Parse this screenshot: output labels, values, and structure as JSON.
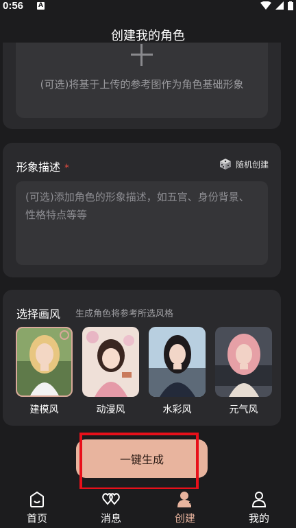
{
  "status": {
    "time": "0:56",
    "notification_letter": "A"
  },
  "header": {
    "title": "创建我的角色"
  },
  "upload": {
    "hint": "(可选)将基于上传的参考图作为角色基础形象"
  },
  "appearance": {
    "title": "形象描述",
    "required_mark": "*",
    "random_label": "随机创建",
    "placeholder": "(可选)添加角色的形象描述，如五官、身份背景、性格特点等等"
  },
  "style": {
    "title": "选择画风",
    "subtitle": "生成角色将参考所选风格",
    "options": [
      {
        "label": "建模风",
        "selected": true
      },
      {
        "label": "动漫风",
        "selected": false
      },
      {
        "label": "水彩风",
        "selected": false
      },
      {
        "label": "元气风",
        "selected": false
      }
    ]
  },
  "generate_label": "一键生成",
  "tabs": [
    {
      "label": "首页",
      "icon": "home-icon"
    },
    {
      "label": "消息",
      "icon": "hearts-icon"
    },
    {
      "label": "创建",
      "icon": "create-user-icon",
      "active": true
    },
    {
      "label": "我的",
      "icon": "profile-icon"
    }
  ],
  "colors": {
    "accent": "#e8b49e",
    "required": "#e04b3f",
    "highlight": "#e8101a"
  }
}
